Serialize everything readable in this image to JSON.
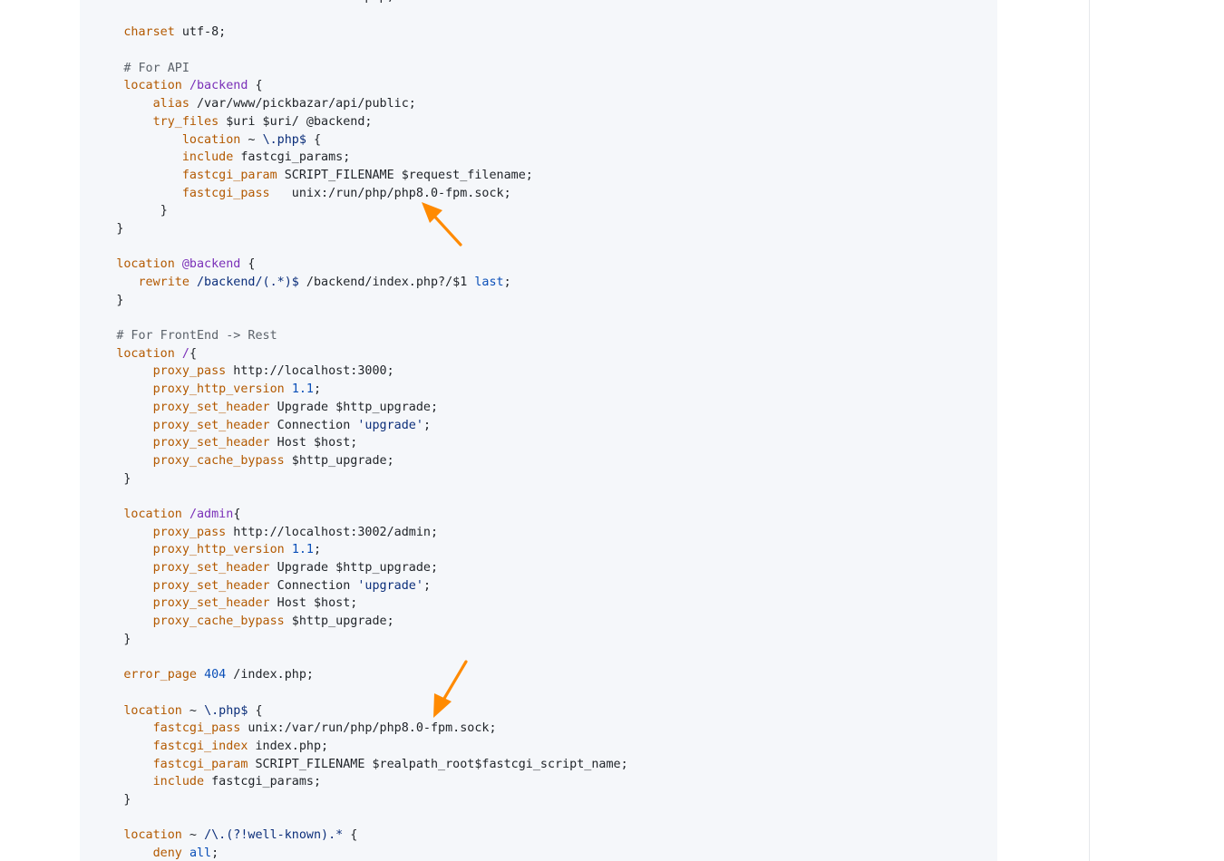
{
  "code_block": {
    "language": "nginx",
    "lines": [
      {
        "indent": "      ",
        "tokens": [
          {
            "t": "kw",
            "v": "index"
          },
          {
            "t": "txt",
            "v": " index.html index.htm index.php;"
          }
        ]
      },
      {
        "indent": "",
        "tokens": []
      },
      {
        "indent": "      ",
        "tokens": [
          {
            "t": "kw",
            "v": "charset"
          },
          {
            "t": "txt",
            "v": " utf-8;"
          }
        ]
      },
      {
        "indent": "",
        "tokens": []
      },
      {
        "indent": "      ",
        "tokens": [
          {
            "t": "cm",
            "v": "# For API"
          }
        ]
      },
      {
        "indent": "      ",
        "tokens": [
          {
            "t": "kw",
            "v": "location"
          },
          {
            "t": "txt",
            "v": " "
          },
          {
            "t": "var",
            "v": "/backend"
          },
          {
            "t": "txt",
            "v": " {"
          }
        ]
      },
      {
        "indent": "          ",
        "tokens": [
          {
            "t": "kw",
            "v": "alias"
          },
          {
            "t": "txt",
            "v": " /var/www/pickbazar/api/public;"
          }
        ]
      },
      {
        "indent": "          ",
        "tokens": [
          {
            "t": "kw",
            "v": "try_files"
          },
          {
            "t": "txt",
            "v": " $uri $uri/ @backend;"
          }
        ]
      },
      {
        "indent": "              ",
        "tokens": [
          {
            "t": "kw",
            "v": "location"
          },
          {
            "t": "txt",
            "v": " ~ "
          },
          {
            "t": "re",
            "v": "\\.php$"
          },
          {
            "t": "txt",
            "v": " {"
          }
        ]
      },
      {
        "indent": "              ",
        "tokens": [
          {
            "t": "kw",
            "v": "include"
          },
          {
            "t": "txt",
            "v": " fastcgi_params;"
          }
        ]
      },
      {
        "indent": "              ",
        "tokens": [
          {
            "t": "kw",
            "v": "fastcgi_param"
          },
          {
            "t": "txt",
            "v": " SCRIPT_FILENAME $request_filename;"
          }
        ]
      },
      {
        "indent": "              ",
        "tokens": [
          {
            "t": "kw",
            "v": "fastcgi_pass"
          },
          {
            "t": "txt",
            "v": "   unix:/run/php/php8.0-fpm.sock;"
          }
        ]
      },
      {
        "indent": "           ",
        "tokens": [
          {
            "t": "txt",
            "v": "}"
          }
        ]
      },
      {
        "indent": "     ",
        "tokens": [
          {
            "t": "txt",
            "v": "}"
          }
        ]
      },
      {
        "indent": "",
        "tokens": []
      },
      {
        "indent": "     ",
        "tokens": [
          {
            "t": "kw",
            "v": "location"
          },
          {
            "t": "txt",
            "v": " "
          },
          {
            "t": "var",
            "v": "@backend"
          },
          {
            "t": "txt",
            "v": " {"
          }
        ]
      },
      {
        "indent": "        ",
        "tokens": [
          {
            "t": "kw",
            "v": "rewrite"
          },
          {
            "t": "txt",
            "v": " "
          },
          {
            "t": "re",
            "v": "/backend/(.*)$"
          },
          {
            "t": "txt",
            "v": " /backend/index.php?/$1 "
          },
          {
            "t": "num",
            "v": "last"
          },
          {
            "t": "txt",
            "v": ";"
          }
        ]
      },
      {
        "indent": "     ",
        "tokens": [
          {
            "t": "txt",
            "v": "}"
          }
        ]
      },
      {
        "indent": "",
        "tokens": []
      },
      {
        "indent": "     ",
        "tokens": [
          {
            "t": "cm",
            "v": "# For FrontEnd -> Rest"
          }
        ]
      },
      {
        "indent": "     ",
        "tokens": [
          {
            "t": "kw",
            "v": "location"
          },
          {
            "t": "txt",
            "v": " "
          },
          {
            "t": "var",
            "v": "/"
          },
          {
            "t": "txt",
            "v": "{"
          }
        ]
      },
      {
        "indent": "          ",
        "tokens": [
          {
            "t": "kw",
            "v": "proxy_pass"
          },
          {
            "t": "txt",
            "v": " http://localhost:3000;"
          }
        ]
      },
      {
        "indent": "          ",
        "tokens": [
          {
            "t": "kw",
            "v": "proxy_http_version"
          },
          {
            "t": "txt",
            "v": " "
          },
          {
            "t": "num",
            "v": "1.1"
          },
          {
            "t": "txt",
            "v": ";"
          }
        ]
      },
      {
        "indent": "          ",
        "tokens": [
          {
            "t": "kw",
            "v": "proxy_set_header"
          },
          {
            "t": "txt",
            "v": " Upgrade $http_upgrade;"
          }
        ]
      },
      {
        "indent": "          ",
        "tokens": [
          {
            "t": "kw",
            "v": "proxy_set_header"
          },
          {
            "t": "txt",
            "v": " Connection "
          },
          {
            "t": "str",
            "v": "'upgrade'"
          },
          {
            "t": "txt",
            "v": ";"
          }
        ]
      },
      {
        "indent": "          ",
        "tokens": [
          {
            "t": "kw",
            "v": "proxy_set_header"
          },
          {
            "t": "txt",
            "v": " Host $host;"
          }
        ]
      },
      {
        "indent": "          ",
        "tokens": [
          {
            "t": "kw",
            "v": "proxy_cache_bypass"
          },
          {
            "t": "txt",
            "v": " $http_upgrade;"
          }
        ]
      },
      {
        "indent": "      ",
        "tokens": [
          {
            "t": "txt",
            "v": "}"
          }
        ]
      },
      {
        "indent": "",
        "tokens": []
      },
      {
        "indent": "      ",
        "tokens": [
          {
            "t": "kw",
            "v": "location"
          },
          {
            "t": "txt",
            "v": " "
          },
          {
            "t": "var",
            "v": "/admin"
          },
          {
            "t": "txt",
            "v": "{"
          }
        ]
      },
      {
        "indent": "          ",
        "tokens": [
          {
            "t": "kw",
            "v": "proxy_pass"
          },
          {
            "t": "txt",
            "v": " http://localhost:3002/admin;"
          }
        ]
      },
      {
        "indent": "          ",
        "tokens": [
          {
            "t": "kw",
            "v": "proxy_http_version"
          },
          {
            "t": "txt",
            "v": " "
          },
          {
            "t": "num",
            "v": "1.1"
          },
          {
            "t": "txt",
            "v": ";"
          }
        ]
      },
      {
        "indent": "          ",
        "tokens": [
          {
            "t": "kw",
            "v": "proxy_set_header"
          },
          {
            "t": "txt",
            "v": " Upgrade $http_upgrade;"
          }
        ]
      },
      {
        "indent": "          ",
        "tokens": [
          {
            "t": "kw",
            "v": "proxy_set_header"
          },
          {
            "t": "txt",
            "v": " Connection "
          },
          {
            "t": "str",
            "v": "'upgrade'"
          },
          {
            "t": "txt",
            "v": ";"
          }
        ]
      },
      {
        "indent": "          ",
        "tokens": [
          {
            "t": "kw",
            "v": "proxy_set_header"
          },
          {
            "t": "txt",
            "v": " Host $host;"
          }
        ]
      },
      {
        "indent": "          ",
        "tokens": [
          {
            "t": "kw",
            "v": "proxy_cache_bypass"
          },
          {
            "t": "txt",
            "v": " $http_upgrade;"
          }
        ]
      },
      {
        "indent": "      ",
        "tokens": [
          {
            "t": "txt",
            "v": "}"
          }
        ]
      },
      {
        "indent": "",
        "tokens": []
      },
      {
        "indent": "      ",
        "tokens": [
          {
            "t": "kw",
            "v": "error_page"
          },
          {
            "t": "txt",
            "v": " "
          },
          {
            "t": "num",
            "v": "404"
          },
          {
            "t": "txt",
            "v": " /index.php;"
          }
        ]
      },
      {
        "indent": "",
        "tokens": []
      },
      {
        "indent": "      ",
        "tokens": [
          {
            "t": "kw",
            "v": "location"
          },
          {
            "t": "txt",
            "v": " ~ "
          },
          {
            "t": "re",
            "v": "\\.php$"
          },
          {
            "t": "txt",
            "v": " {"
          }
        ]
      },
      {
        "indent": "          ",
        "tokens": [
          {
            "t": "kw",
            "v": "fastcgi_pass"
          },
          {
            "t": "txt",
            "v": " unix:/var/run/php/php8.0-fpm.sock;"
          }
        ]
      },
      {
        "indent": "          ",
        "tokens": [
          {
            "t": "kw",
            "v": "fastcgi_index"
          },
          {
            "t": "txt",
            "v": " index.php;"
          }
        ]
      },
      {
        "indent": "          ",
        "tokens": [
          {
            "t": "kw",
            "v": "fastcgi_param"
          },
          {
            "t": "txt",
            "v": " SCRIPT_FILENAME $realpath_root$fastcgi_script_name;"
          }
        ]
      },
      {
        "indent": "          ",
        "tokens": [
          {
            "t": "kw",
            "v": "include"
          },
          {
            "t": "txt",
            "v": " fastcgi_params;"
          }
        ]
      },
      {
        "indent": "      ",
        "tokens": [
          {
            "t": "txt",
            "v": "}"
          }
        ]
      },
      {
        "indent": "",
        "tokens": []
      },
      {
        "indent": "      ",
        "tokens": [
          {
            "t": "kw",
            "v": "location"
          },
          {
            "t": "txt",
            "v": " ~ "
          },
          {
            "t": "re",
            "v": "/\\.(?!well-known).*"
          },
          {
            "t": "txt",
            "v": " {"
          }
        ]
      },
      {
        "indent": "          ",
        "tokens": [
          {
            "t": "kw",
            "v": "deny"
          },
          {
            "t": "txt",
            "v": " "
          },
          {
            "t": "num",
            "v": "all"
          },
          {
            "t": "txt",
            "v": ";"
          }
        ]
      }
    ]
  },
  "annotations": {
    "arrow_color": "#ff8a00",
    "arrows": [
      {
        "name": "arrow-fpm-sock-api",
        "points_to": "php8.0-fpm.sock (API block)"
      },
      {
        "name": "arrow-fpm-sock-php",
        "points_to": "php8.0-fpm.sock (php block)"
      }
    ]
  },
  "colors": {
    "background": "#ffffff",
    "code_background": "#f5f7fa",
    "directive": "#b35900",
    "variable": "#7a2fb8",
    "regex_string": "#0b2e7a",
    "number": "#0a4fb8",
    "comment": "#5c636b",
    "text": "#1f2328"
  }
}
